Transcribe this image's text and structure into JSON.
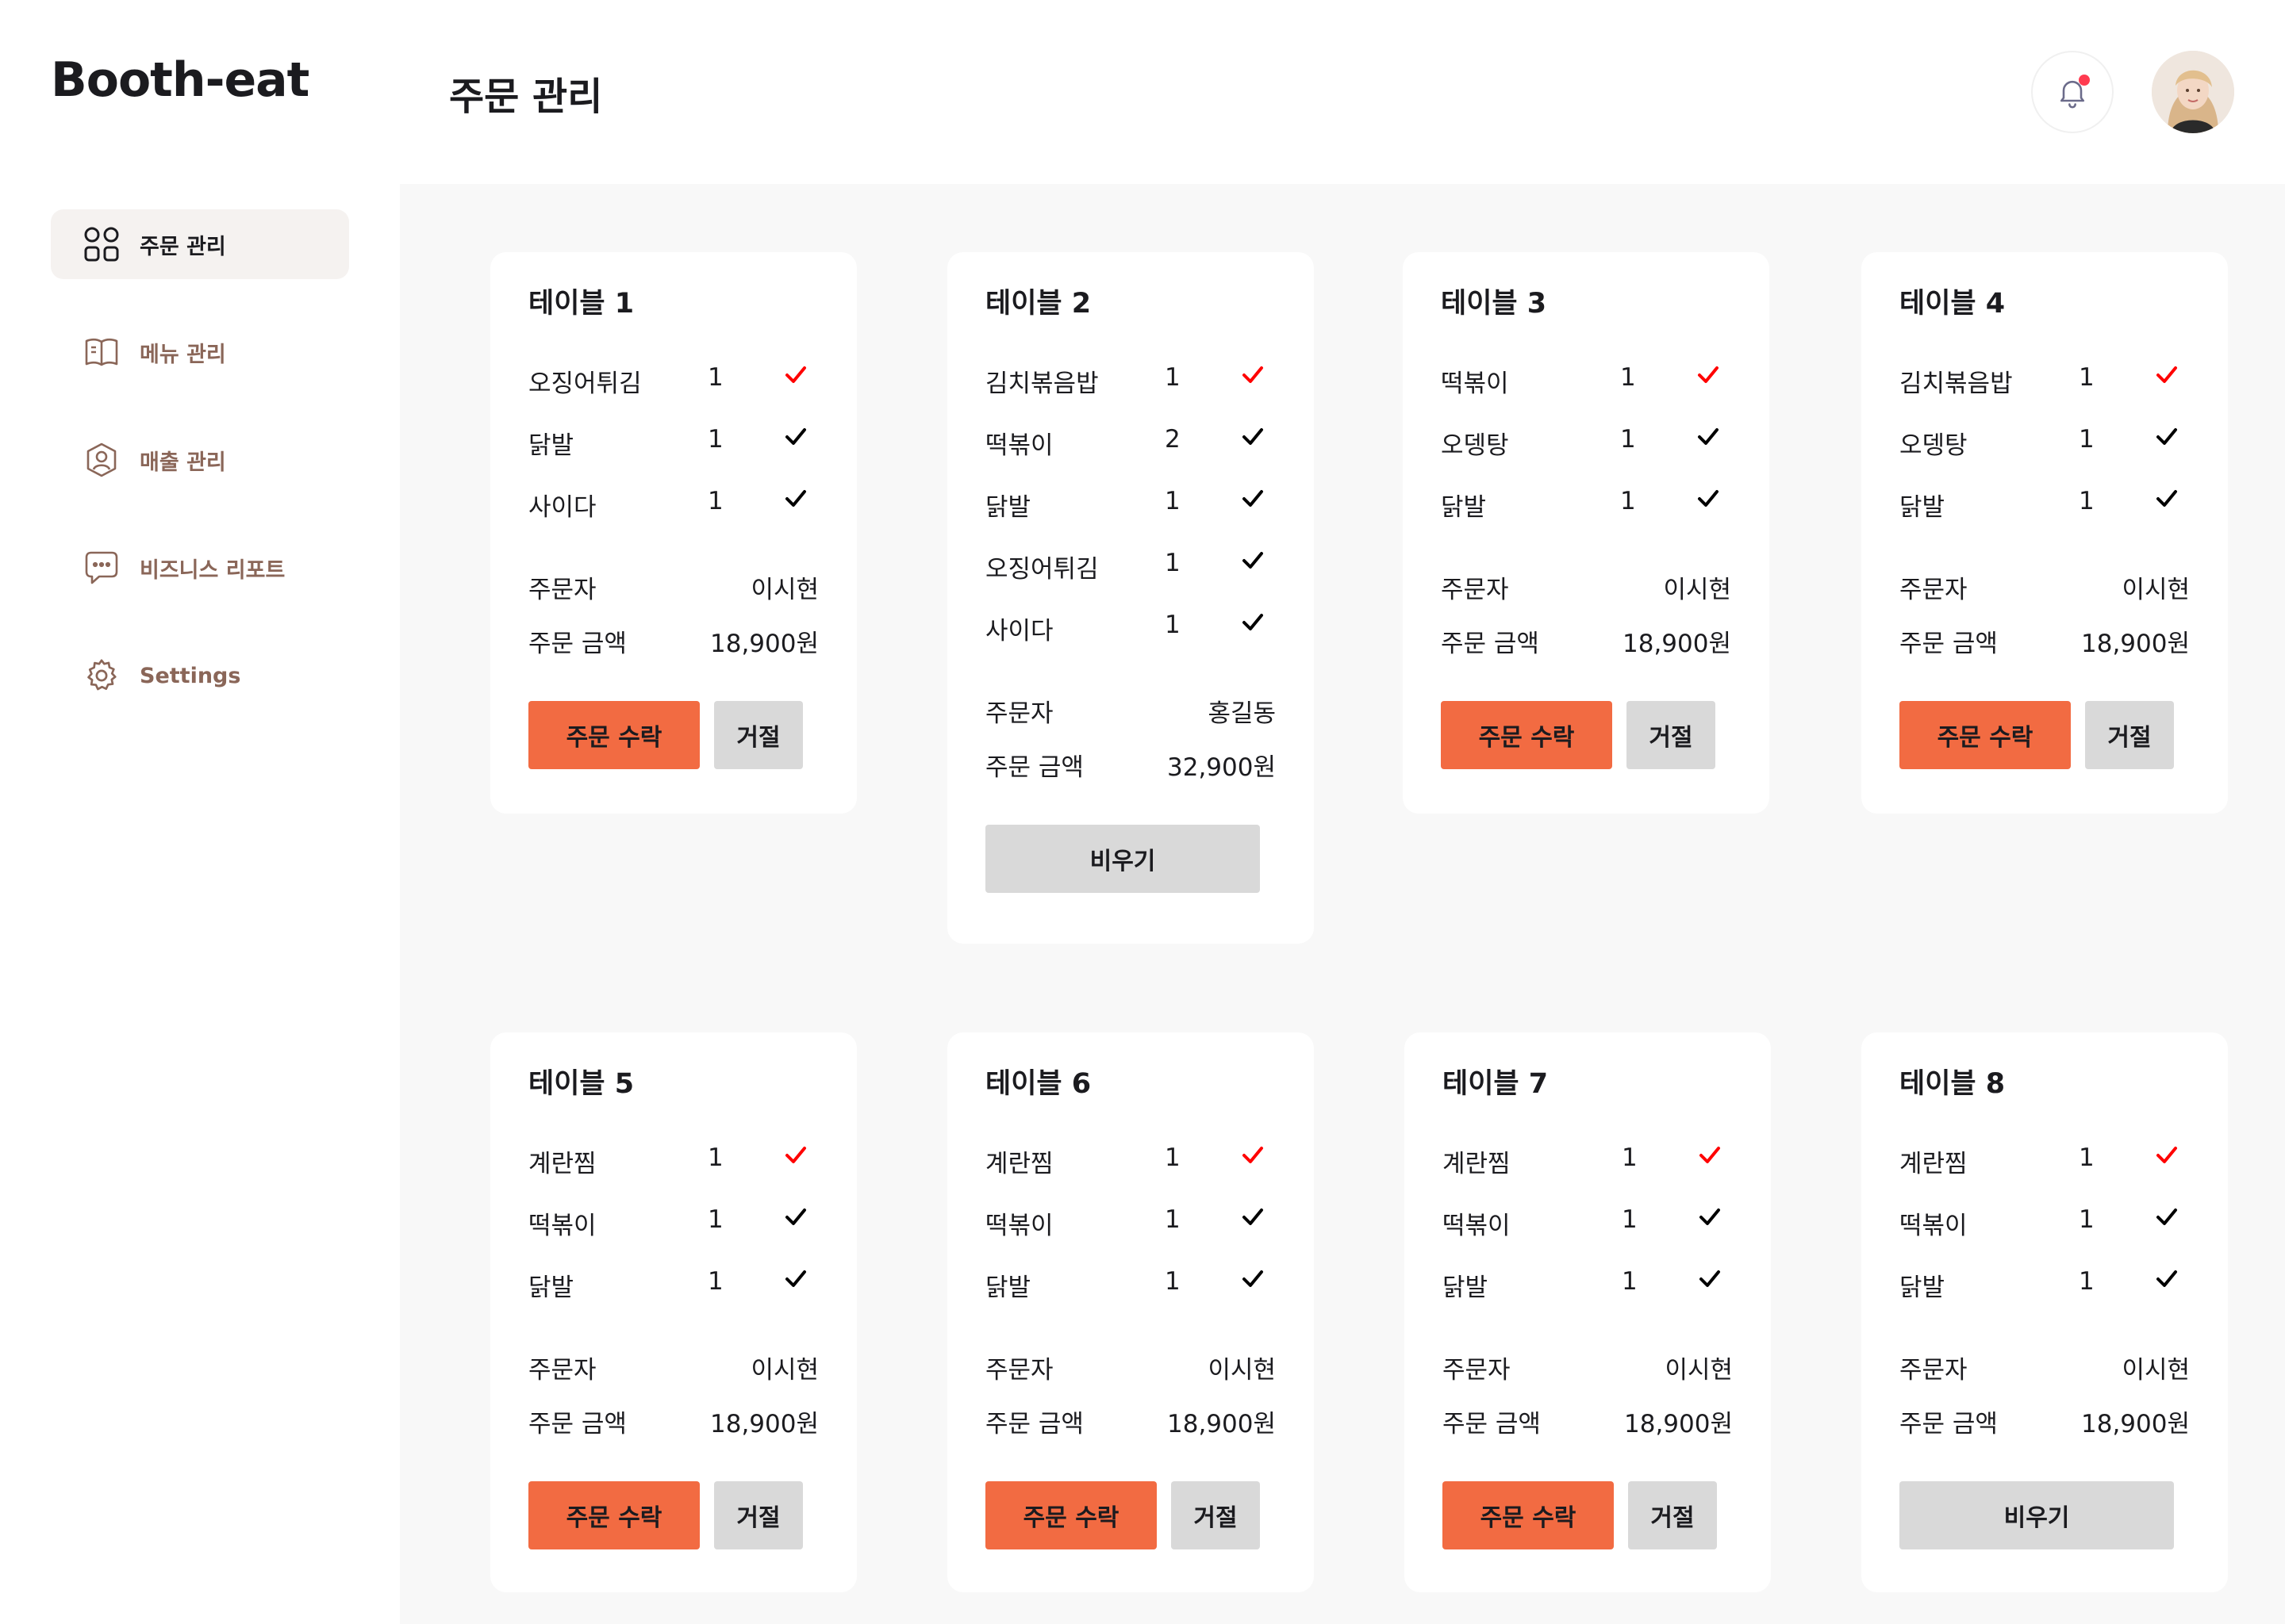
{
  "app": {
    "logo": "Booth-eat",
    "page_title": "주문 관리"
  },
  "header": {
    "notification_icon": "bell-icon",
    "avatar_icon": "user-avatar"
  },
  "sidebar": {
    "items": [
      {
        "label": "주문 관리",
        "icon": "grid-icon",
        "active": true
      },
      {
        "label": "메뉴 관리",
        "icon": "book-icon",
        "active": false
      },
      {
        "label": "매출 관리",
        "icon": "user-shield-icon",
        "active": false
      },
      {
        "label": "비즈니스 리포트",
        "icon": "chat-icon",
        "active": false
      },
      {
        "label": "Settings",
        "icon": "gear-icon",
        "active": false
      }
    ]
  },
  "labels": {
    "orderer": "주문자",
    "amount": "주문 금액",
    "accept": "주문 수락",
    "reject": "거절",
    "clear": "비우기"
  },
  "colors": {
    "accent": "#f26b42",
    "new_check": "#ff0000",
    "done_check": "#000000",
    "muted_text": "#8a6658"
  },
  "tables": [
    {
      "title": "테이블 1",
      "items": [
        {
          "name": "오징어튀김",
          "qty": "1",
          "new": true
        },
        {
          "name": "닭발",
          "qty": "1",
          "new": false
        },
        {
          "name": "사이다",
          "qty": "1",
          "new": false
        }
      ],
      "orderer": "이시현",
      "amount": "18,900원",
      "status": "pending"
    },
    {
      "title": "테이블 2",
      "items": [
        {
          "name": "김치볶음밥",
          "qty": "1",
          "new": true
        },
        {
          "name": "떡볶이",
          "qty": "2",
          "new": false
        },
        {
          "name": "닭발",
          "qty": "1",
          "new": false
        },
        {
          "name": "오징어튀김",
          "qty": "1",
          "new": false
        },
        {
          "name": "사이다",
          "qty": "1",
          "new": false
        }
      ],
      "orderer": "홍길동",
      "amount": "32,900원",
      "status": "accepted"
    },
    {
      "title": "테이블 3",
      "items": [
        {
          "name": "떡볶이",
          "qty": "1",
          "new": true
        },
        {
          "name": "오뎅탕",
          "qty": "1",
          "new": false
        },
        {
          "name": "닭발",
          "qty": "1",
          "new": false
        }
      ],
      "orderer": "이시현",
      "amount": "18,900원",
      "status": "pending"
    },
    {
      "title": "테이블 4",
      "items": [
        {
          "name": "김치볶음밥",
          "qty": "1",
          "new": true
        },
        {
          "name": "오뎅탕",
          "qty": "1",
          "new": false
        },
        {
          "name": "닭발",
          "qty": "1",
          "new": false
        }
      ],
      "orderer": "이시현",
      "amount": "18,900원",
      "status": "pending"
    },
    {
      "title": "테이블 5",
      "items": [
        {
          "name": "계란찜",
          "qty": "1",
          "new": true
        },
        {
          "name": "떡볶이",
          "qty": "1",
          "new": false
        },
        {
          "name": "닭발",
          "qty": "1",
          "new": false
        }
      ],
      "orderer": "이시현",
      "amount": "18,900원",
      "status": "pending"
    },
    {
      "title": "테이블 6",
      "items": [
        {
          "name": "계란찜",
          "qty": "1",
          "new": true
        },
        {
          "name": "떡볶이",
          "qty": "1",
          "new": false
        },
        {
          "name": "닭발",
          "qty": "1",
          "new": false
        }
      ],
      "orderer": "이시현",
      "amount": "18,900원",
      "status": "pending"
    },
    {
      "title": "테이블 7",
      "items": [
        {
          "name": "계란찜",
          "qty": "1",
          "new": true
        },
        {
          "name": "떡볶이",
          "qty": "1",
          "new": false
        },
        {
          "name": "닭발",
          "qty": "1",
          "new": false
        }
      ],
      "orderer": "이시현",
      "amount": "18,900원",
      "status": "pending"
    },
    {
      "title": "테이블 8",
      "items": [
        {
          "name": "계란찜",
          "qty": "1",
          "new": true
        },
        {
          "name": "떡볶이",
          "qty": "1",
          "new": false
        },
        {
          "name": "닭발",
          "qty": "1",
          "new": false
        }
      ],
      "orderer": "이시현",
      "amount": "18,900원",
      "status": "accepted"
    }
  ]
}
